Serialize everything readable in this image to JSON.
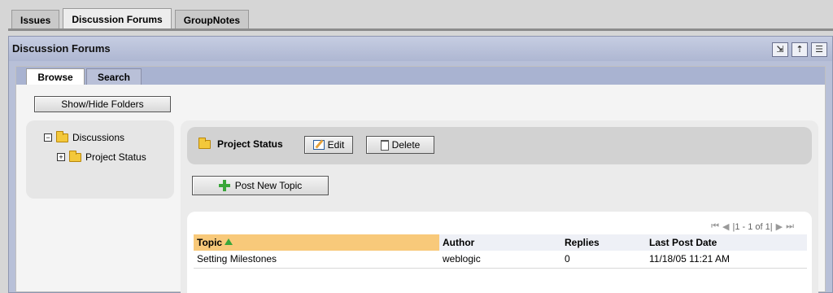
{
  "top_tabs": [
    {
      "label": "Issues"
    },
    {
      "label": "Discussion Forums"
    },
    {
      "label": "GroupNotes"
    }
  ],
  "portlet": {
    "title": "Discussion Forums",
    "icons": [
      "export-icon",
      "help-icon",
      "preferences-icon"
    ]
  },
  "inner_tabs": [
    {
      "label": "Browse"
    },
    {
      "label": "Search"
    }
  ],
  "show_hide_label": "Show/Hide Folders",
  "tree": {
    "root": {
      "label": "Discussions",
      "toggle": "⊟"
    },
    "child": {
      "label": "Project Status",
      "toggle": "⊞"
    }
  },
  "topic": {
    "name": "Project Status",
    "edit_label": "Edit",
    "delete_label": "Delete",
    "post_label": "Post New Topic"
  },
  "pager": {
    "text": "1 - 1 of 1"
  },
  "table": {
    "headers": {
      "topic": "Topic",
      "author": "Author",
      "replies": "Replies",
      "last_post": "Last Post Date"
    },
    "rows": [
      {
        "topic": "Setting Milestones",
        "author": "weblogic",
        "replies": "0",
        "last_post": "11/18/05 11:21 AM"
      }
    ]
  },
  "colors": {
    "portlet_header": "#b8c0d8",
    "sort_header": "#f8c97a",
    "folder": "#f3c83b"
  }
}
